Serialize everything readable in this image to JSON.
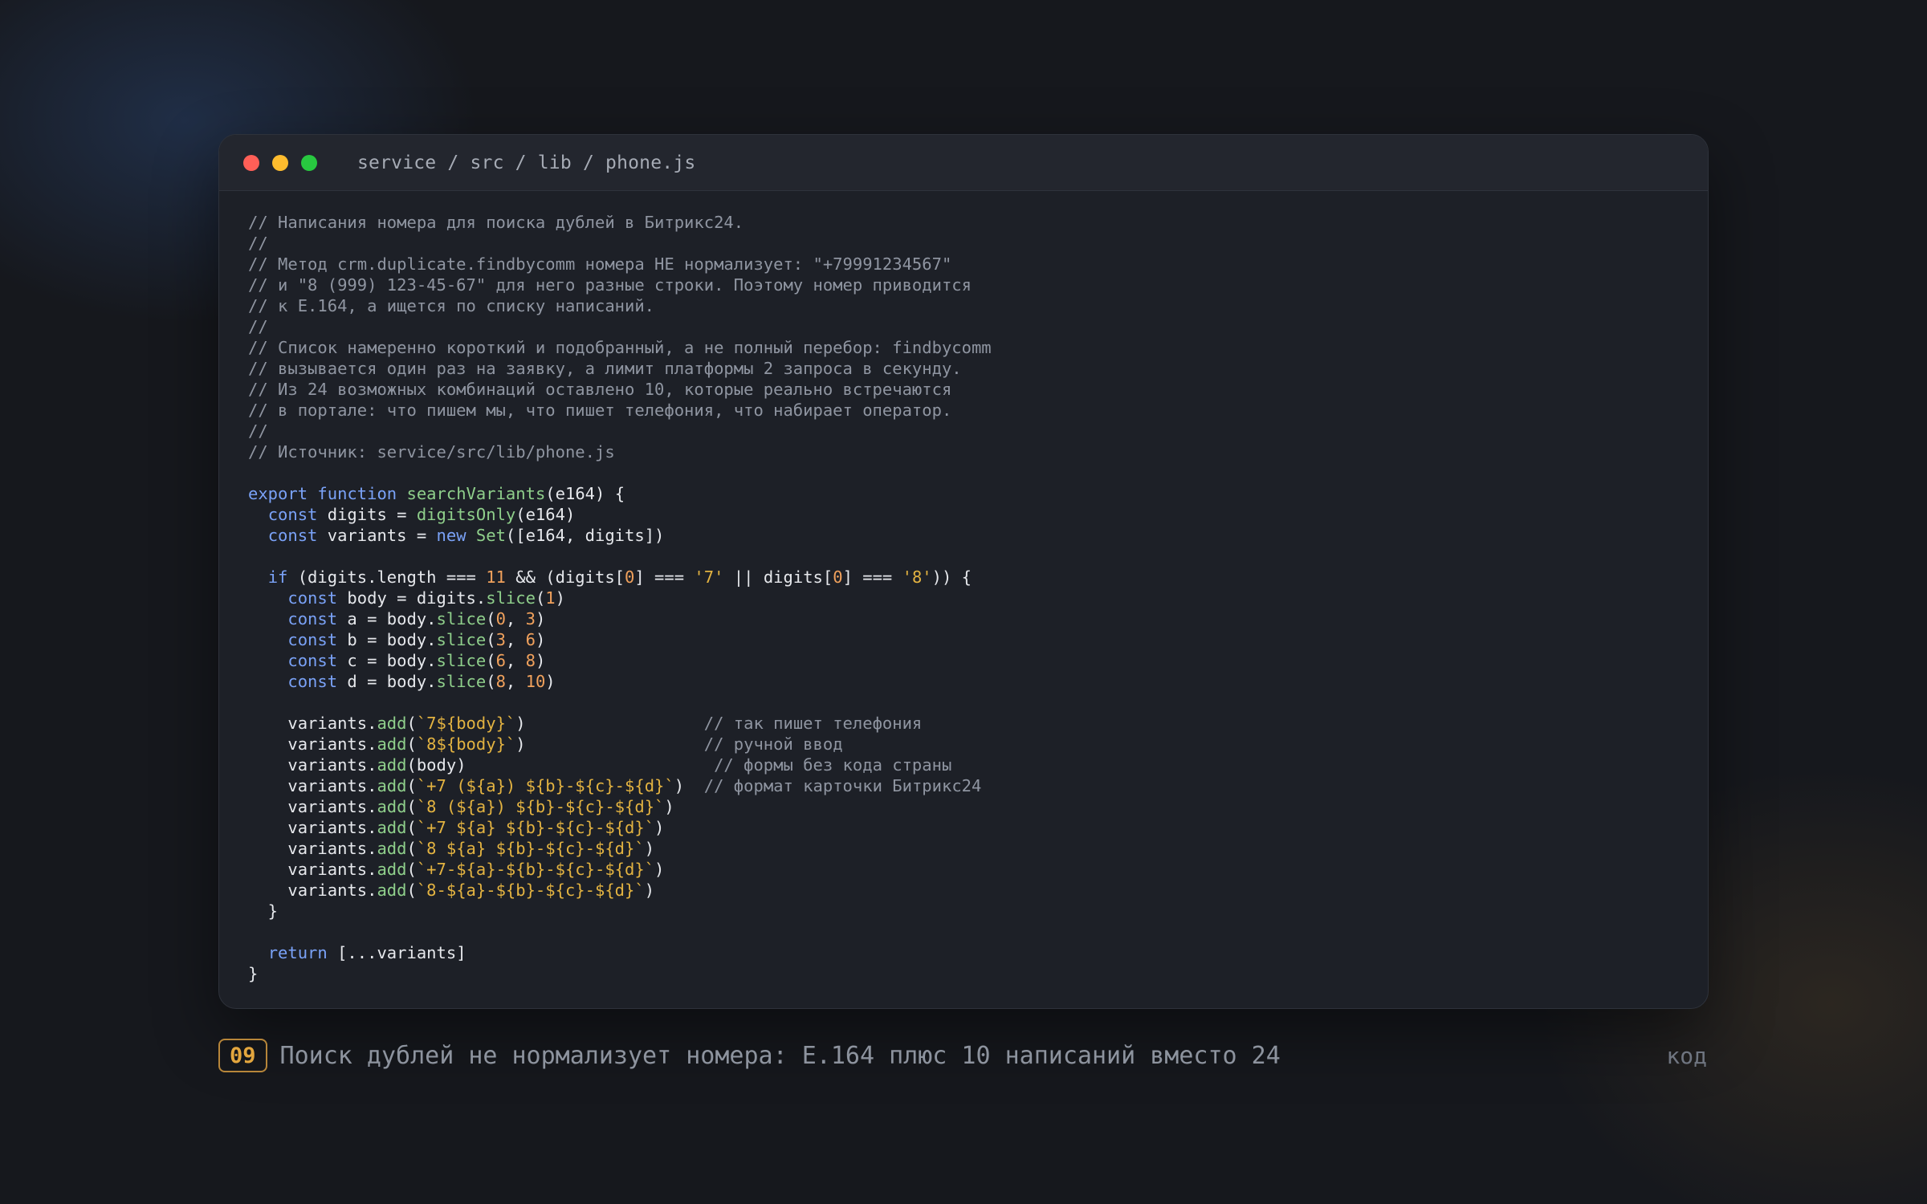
{
  "window": {
    "breadcrumb": "service / src / lib / phone.js",
    "controls": [
      "close",
      "minimize",
      "maximize"
    ]
  },
  "code": [
    [
      [
        "c",
        "// Написания номера для поиска дублей в Битрикс24."
      ]
    ],
    [
      [
        "c",
        "//"
      ]
    ],
    [
      [
        "c",
        "// Метод crm.duplicate.findbycomm номера НЕ нормализует: \"+79991234567\""
      ]
    ],
    [
      [
        "c",
        "// и \"8 (999) 123-45-67\" для него разные строки. Поэтому номер приводится"
      ]
    ],
    [
      [
        "c",
        "// к E.164, а ищется по списку написаний."
      ]
    ],
    [
      [
        "c",
        "//"
      ]
    ],
    [
      [
        "c",
        "// Список намеренно короткий и подобранный, а не полный перебор: findbycomm"
      ]
    ],
    [
      [
        "c",
        "// вызывается один раз на заявку, а лимит платформы 2 запроса в секунду."
      ]
    ],
    [
      [
        "c",
        "// Из 24 возможных комбинаций оставлено 10, которые реально встречаются"
      ]
    ],
    [
      [
        "c",
        "// в портале: что пишем мы, что пишет телефония, что набирает оператор."
      ]
    ],
    [
      [
        "c",
        "//"
      ]
    ],
    [
      [
        "c",
        "// Источник: service/src/lib/phone.js"
      ]
    ],
    [],
    [
      [
        "k",
        "export"
      ],
      [
        "p",
        " "
      ],
      [
        "k",
        "function"
      ],
      [
        "p",
        " "
      ],
      [
        "f",
        "searchVariants"
      ],
      [
        "p",
        "(e164) {"
      ]
    ],
    [
      [
        "p",
        "  "
      ],
      [
        "k",
        "const"
      ],
      [
        "p",
        " digits = "
      ],
      [
        "f",
        "digitsOnly"
      ],
      [
        "p",
        "(e164)"
      ]
    ],
    [
      [
        "p",
        "  "
      ],
      [
        "k",
        "const"
      ],
      [
        "p",
        " variants = "
      ],
      [
        "k",
        "new"
      ],
      [
        "p",
        " "
      ],
      [
        "f",
        "Set"
      ],
      [
        "p",
        "([e164, digits])"
      ]
    ],
    [],
    [
      [
        "p",
        "  "
      ],
      [
        "k",
        "if"
      ],
      [
        "p",
        " (digits.length === "
      ],
      [
        "n",
        "11"
      ],
      [
        "p",
        " && (digits["
      ],
      [
        "n",
        "0"
      ],
      [
        "p",
        "] === "
      ],
      [
        "s",
        "'7'"
      ],
      [
        "p",
        " || digits["
      ],
      [
        "n",
        "0"
      ],
      [
        "p",
        "] === "
      ],
      [
        "s",
        "'8'"
      ],
      [
        "p",
        ")) {"
      ]
    ],
    [
      [
        "p",
        "    "
      ],
      [
        "k",
        "const"
      ],
      [
        "p",
        " body = digits."
      ],
      [
        "f",
        "slice"
      ],
      [
        "p",
        "("
      ],
      [
        "n",
        "1"
      ],
      [
        "p",
        ")"
      ]
    ],
    [
      [
        "p",
        "    "
      ],
      [
        "k",
        "const"
      ],
      [
        "p",
        " a = body."
      ],
      [
        "f",
        "slice"
      ],
      [
        "p",
        "("
      ],
      [
        "n",
        "0"
      ],
      [
        "p",
        ", "
      ],
      [
        "n",
        "3"
      ],
      [
        "p",
        ")"
      ]
    ],
    [
      [
        "p",
        "    "
      ],
      [
        "k",
        "const"
      ],
      [
        "p",
        " b = body."
      ],
      [
        "f",
        "slice"
      ],
      [
        "p",
        "("
      ],
      [
        "n",
        "3"
      ],
      [
        "p",
        ", "
      ],
      [
        "n",
        "6"
      ],
      [
        "p",
        ")"
      ]
    ],
    [
      [
        "p",
        "    "
      ],
      [
        "k",
        "const"
      ],
      [
        "p",
        " c = body."
      ],
      [
        "f",
        "slice"
      ],
      [
        "p",
        "("
      ],
      [
        "n",
        "6"
      ],
      [
        "p",
        ", "
      ],
      [
        "n",
        "8"
      ],
      [
        "p",
        ")"
      ]
    ],
    [
      [
        "p",
        "    "
      ],
      [
        "k",
        "const"
      ],
      [
        "p",
        " d = body."
      ],
      [
        "f",
        "slice"
      ],
      [
        "p",
        "("
      ],
      [
        "n",
        "8"
      ],
      [
        "p",
        ", "
      ],
      [
        "n",
        "10"
      ],
      [
        "p",
        ")"
      ]
    ],
    [],
    [
      [
        "p",
        "    variants."
      ],
      [
        "f",
        "add"
      ],
      [
        "p",
        "("
      ],
      [
        "s",
        "`7${body}`"
      ],
      [
        "p",
        ")                  "
      ],
      [
        "c",
        "// так пишет телефония"
      ]
    ],
    [
      [
        "p",
        "    variants."
      ],
      [
        "f",
        "add"
      ],
      [
        "p",
        "("
      ],
      [
        "s",
        "`8${body}`"
      ],
      [
        "p",
        ")                  "
      ],
      [
        "c",
        "// ручной ввод"
      ]
    ],
    [
      [
        "p",
        "    variants."
      ],
      [
        "f",
        "add"
      ],
      [
        "p",
        "(body)                         "
      ],
      [
        "c",
        "// формы без кода страны"
      ]
    ],
    [
      [
        "p",
        "    variants."
      ],
      [
        "f",
        "add"
      ],
      [
        "p",
        "("
      ],
      [
        "s",
        "`+7 (${a}) ${b}-${c}-${d}`"
      ],
      [
        "p",
        ")  "
      ],
      [
        "c",
        "// формат карточки Битрикс24"
      ]
    ],
    [
      [
        "p",
        "    variants."
      ],
      [
        "f",
        "add"
      ],
      [
        "p",
        "("
      ],
      [
        "s",
        "`8 (${a}) ${b}-${c}-${d}`"
      ],
      [
        "p",
        ")"
      ]
    ],
    [
      [
        "p",
        "    variants."
      ],
      [
        "f",
        "add"
      ],
      [
        "p",
        "("
      ],
      [
        "s",
        "`+7 ${a} ${b}-${c}-${d}`"
      ],
      [
        "p",
        ")"
      ]
    ],
    [
      [
        "p",
        "    variants."
      ],
      [
        "f",
        "add"
      ],
      [
        "p",
        "("
      ],
      [
        "s",
        "`8 ${a} ${b}-${c}-${d}`"
      ],
      [
        "p",
        ")"
      ]
    ],
    [
      [
        "p",
        "    variants."
      ],
      [
        "f",
        "add"
      ],
      [
        "p",
        "("
      ],
      [
        "s",
        "`+7-${a}-${b}-${c}-${d}`"
      ],
      [
        "p",
        ")"
      ]
    ],
    [
      [
        "p",
        "    variants."
      ],
      [
        "f",
        "add"
      ],
      [
        "p",
        "("
      ],
      [
        "s",
        "`8-${a}-${b}-${c}-${d}`"
      ],
      [
        "p",
        ")"
      ]
    ],
    [
      [
        "p",
        "  }"
      ]
    ],
    [],
    [
      [
        "p",
        "  "
      ],
      [
        "k",
        "return"
      ],
      [
        "p",
        " [...variants]"
      ]
    ],
    [
      [
        "p",
        "}"
      ]
    ]
  ],
  "caption": {
    "number": "09",
    "text": "Поиск дублей не нормализует номера: E.164 плюс 10 написаний вместо 24",
    "tag": "код"
  }
}
